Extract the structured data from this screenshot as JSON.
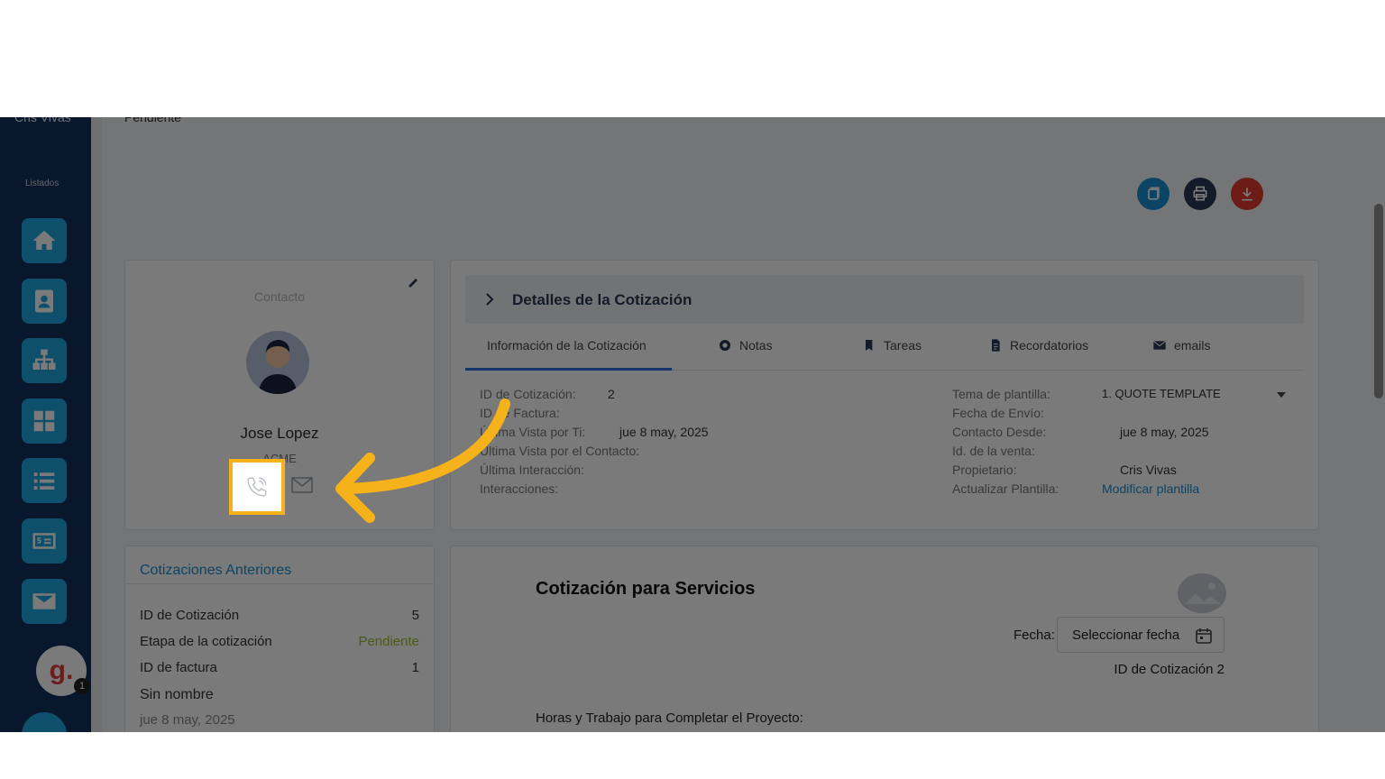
{
  "sidebar": {
    "user_name": "Cris Vivas",
    "section_label": "Listados",
    "items": [
      {
        "icon": "home-icon"
      },
      {
        "icon": "contacts-icon"
      },
      {
        "icon": "org-chart-icon"
      },
      {
        "icon": "grid-icon"
      },
      {
        "icon": "list-icon"
      },
      {
        "icon": "invoice-icon"
      },
      {
        "icon": "mail-icon"
      }
    ],
    "avatar_letter": "g.",
    "badge_count": "1"
  },
  "top": {
    "stage_text": "Pendiente"
  },
  "actions": [
    {
      "name": "copy-button",
      "icon": "copy-icon",
      "color": "#1a8fd6"
    },
    {
      "name": "print-button",
      "icon": "print-icon",
      "color": "#2b3a55"
    },
    {
      "name": "download-button",
      "icon": "download-icon",
      "color": "#e03b2d"
    }
  ],
  "contact": {
    "title": "Contacto",
    "name": "Jose Lopez",
    "company": "ACME"
  },
  "details": {
    "title": "Detalles de la Cotización",
    "tabs": [
      {
        "label": "Información de la Cotización"
      },
      {
        "label": "Notas"
      },
      {
        "label": "Tareas"
      },
      {
        "label": "Recordatorios"
      },
      {
        "label": "emails"
      }
    ],
    "left": {
      "id_cotizacion_label": "ID de Cotización:",
      "id_cotizacion_value": "2",
      "id_factura_label": "ID de Factura:",
      "ultima_vista_ti_label": "Última Vista por Ti:",
      "ultima_vista_ti_value": "jue 8 may, 2025",
      "ultima_vista_contacto_label": "Última Vista por el Contacto:",
      "ultima_interaccion_label": "Última Interacción:",
      "interacciones_label": "Interacciones:"
    },
    "right": {
      "tema_label": "Tema de plantilla:",
      "tema_value": "1. QUOTE TEMPLATE",
      "fecha_envio_label": "Fecha de Envío:",
      "contacto_desde_label": "Contacto Desde:",
      "contacto_desde_value": "jue 8 may, 2025",
      "id_venta_label": "Id. de la venta:",
      "propietario_label": "Propietario:",
      "propietario_value": "Cris Vivas",
      "actualizar_label": "Actualizar Plantilla:",
      "actualizar_link": "Modificar plantilla"
    }
  },
  "previous": {
    "title": "Cotizaciones Anteriores",
    "rows": [
      {
        "label": "ID de Cotización",
        "value": "5"
      },
      {
        "label": "Etapa de la cotización",
        "value": "Pendiente"
      },
      {
        "label": "ID de factura",
        "value": "1"
      }
    ],
    "name_link": "Sin nombre",
    "date": "jue 8 may, 2025",
    "stage_color": "#9bbd2a"
  },
  "quote": {
    "title": "Cotización para Servicios",
    "fecha_label": "Fecha:",
    "fecha_placeholder": "Seleccionar fecha",
    "id_label": "ID de Cotización 2",
    "horas_label": "Horas y Trabajo para Completar el Proyecto:"
  },
  "colors": {
    "sidebar_bg": "#13315c",
    "accent": "#1ea7e1",
    "highlight": "#f6b21b"
  }
}
